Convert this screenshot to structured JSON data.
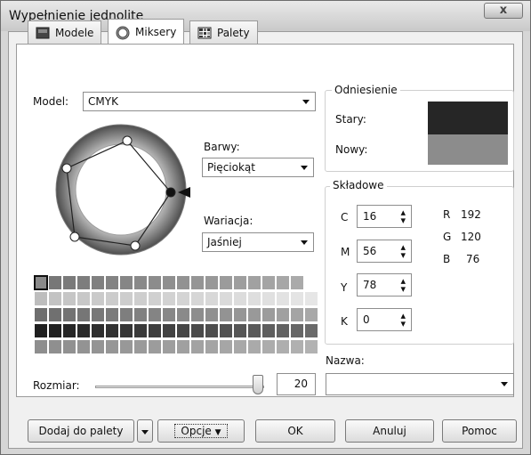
{
  "window": {
    "title": "Wypełnienie jednolite",
    "close_glyph": "x"
  },
  "tabs": [
    {
      "label": "Modele",
      "icon": "square-icon"
    },
    {
      "label": "Miksery",
      "icon": "ring-icon",
      "active": true
    },
    {
      "label": "Palety",
      "icon": "palette-grid-icon"
    }
  ],
  "model": {
    "label": "Model:",
    "value": "CMYK"
  },
  "harmonies": {
    "label": "Barwy:",
    "value": "Pięciokąt"
  },
  "variation": {
    "label": "Wariacja:",
    "value": "Jaśniej"
  },
  "reference": {
    "title": "Odniesienie",
    "old_label": "Stary:",
    "new_label": "Nowy:",
    "old_color": "#262626",
    "new_color": "#8c8c8c"
  },
  "components": {
    "title": "Składowe",
    "c": {
      "label": "C",
      "value": "16"
    },
    "m": {
      "label": "M",
      "value": "56"
    },
    "y": {
      "label": "Y",
      "value": "78"
    },
    "k": {
      "label": "K",
      "value": "0"
    },
    "r": {
      "label": "R",
      "value": "192"
    },
    "g": {
      "label": "G",
      "value": "120"
    },
    "b": {
      "label": "B",
      "value": "76"
    }
  },
  "name": {
    "label": "Nazwa:",
    "value": ""
  },
  "size": {
    "label": "Rozmiar:",
    "value": "20"
  },
  "buttons": {
    "add_to_palette": "Dodaj do palety",
    "options": "Opcje",
    "ok": "OK",
    "cancel": "Anuluj",
    "help": "Pomoc"
  },
  "grid_rows": [
    [
      "#8a8a8a",
      "#777777",
      "#7a7a7a",
      "#7d7d7d",
      "#808080",
      "#838383",
      "#868686",
      "#898989",
      "#8c8c8c",
      "#8f8f8f",
      "#929292",
      "#959595",
      "#989898",
      "#9b9b9b",
      "#9e9e9e",
      "#a1a1a1",
      "#a4a4a4",
      "#a7a7a7",
      "#aaaaaa",
      "#ffffff"
    ],
    [
      "#bdbdbd",
      "#c3c3c3",
      "#c6c6c6",
      "#c8c8c8",
      "#cacaca",
      "#cccccc",
      "#cdcdcd",
      "#cecece",
      "#d0d0d0",
      "#d2d2d2",
      "#d4d4d4",
      "#d6d6d6",
      "#d8d8d8",
      "#dadada",
      "#dcdcdc",
      "#dedede",
      "#e0e0e0",
      "#e2e2e2",
      "#e4e4e4",
      "#e6e6e6"
    ],
    [
      "#6e6e6e",
      "#707070",
      "#737373",
      "#767676",
      "#787878",
      "#7b7b7b",
      "#7e7e7e",
      "#818181",
      "#848484",
      "#878787",
      "#8a8a8a",
      "#8d8d8d",
      "#909090",
      "#939393",
      "#969696",
      "#999999",
      "#9c9c9c",
      "#a0a0a0",
      "#a4a4a4",
      "#a8a8a8"
    ],
    [
      "#1f1f1f",
      "#222222",
      "#262626",
      "#2a2a2a",
      "#2e2e2e",
      "#323232",
      "#363636",
      "#3a3a3a",
      "#3e3e3e",
      "#424242",
      "#464646",
      "#4a4a4a",
      "#4e4e4e",
      "#525252",
      "#565656",
      "#5a5a5a",
      "#5e5e5e",
      "#626262",
      "#666666",
      "#6a6a6a"
    ],
    [
      "#8e8e8e",
      "#8f8f8f",
      "#919191",
      "#939393",
      "#949494",
      "#969696",
      "#989898",
      "#9a9a9a",
      "#9c9c9c",
      "#9e9e9e",
      "#a0a0a0",
      "#a2a2a2",
      "#a4a4a4",
      "#a6a6a6",
      "#a8a8a8",
      "#aaaaaa",
      "#acacac",
      "#aeaeae",
      "#b0b0b0",
      "#b2b2b2"
    ]
  ]
}
